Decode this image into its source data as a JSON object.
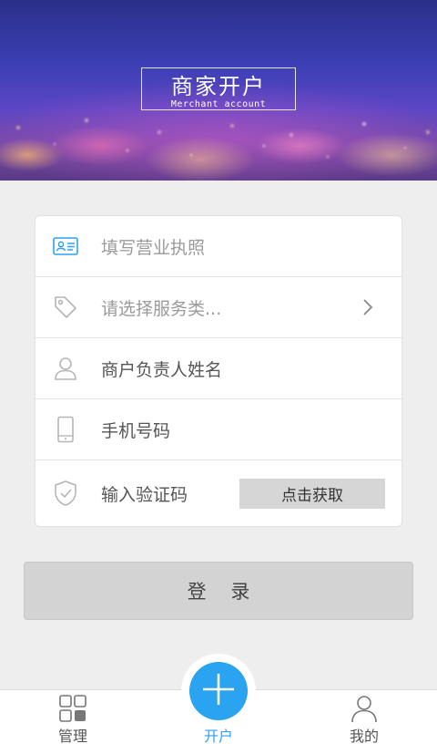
{
  "banner": {
    "title": "商家开户",
    "subtitle": "Merchant account"
  },
  "form": {
    "license": {
      "placeholder": "填写营业执照",
      "icon": "id-card-icon"
    },
    "service": {
      "placeholder": "请选择服务类...",
      "icon": "tag-icon"
    },
    "owner_name": {
      "value": "商户负责人姓名",
      "icon": "user-icon"
    },
    "phone": {
      "value": "手机号码",
      "icon": "phone-icon"
    },
    "code": {
      "value": "输入验证码",
      "icon": "shield-check-icon",
      "button_label": "点击获取"
    }
  },
  "login_label": "登 录",
  "tabbar": {
    "manage": "管理",
    "open": "开户",
    "mine": "我的"
  },
  "colors": {
    "accent": "#2aa3f0",
    "button_gray": "#d3d3d3",
    "background": "#eeeeee"
  }
}
